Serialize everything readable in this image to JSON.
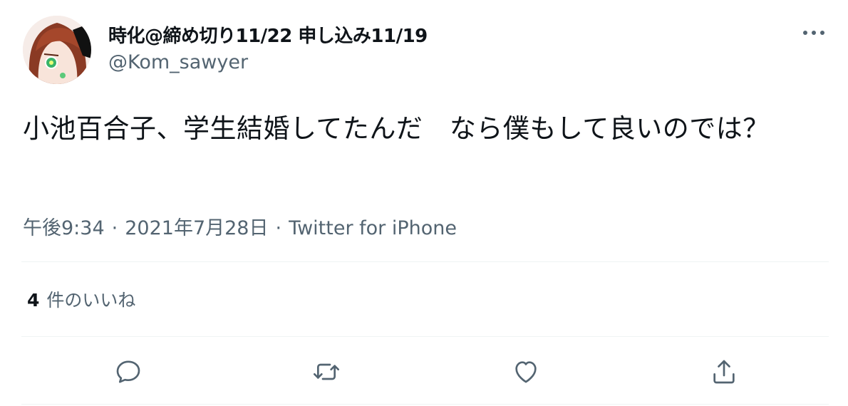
{
  "author": {
    "display_name": "時化@締め切り11/22 申し込み11/19",
    "handle": "@Kom_sawyer",
    "avatar_icon": "anime-character-avatar"
  },
  "tweet": {
    "text": "小池百合子、学生結婚してたんだ　なら僕もして良いのでは？"
  },
  "meta": {
    "time": "午後9:34",
    "separator": "·",
    "date": "2021年7月28日",
    "source": "Twitter for iPhone"
  },
  "stats": {
    "likes_count": "4",
    "likes_label": "件のいいね"
  },
  "actions": {
    "reply_icon": "reply-icon",
    "retweet_icon": "retweet-icon",
    "like_icon": "heart-icon",
    "share_icon": "share-icon"
  },
  "colors": {
    "text_primary": "#0f1419",
    "text_secondary": "#536471",
    "divider": "#eff3f4"
  }
}
